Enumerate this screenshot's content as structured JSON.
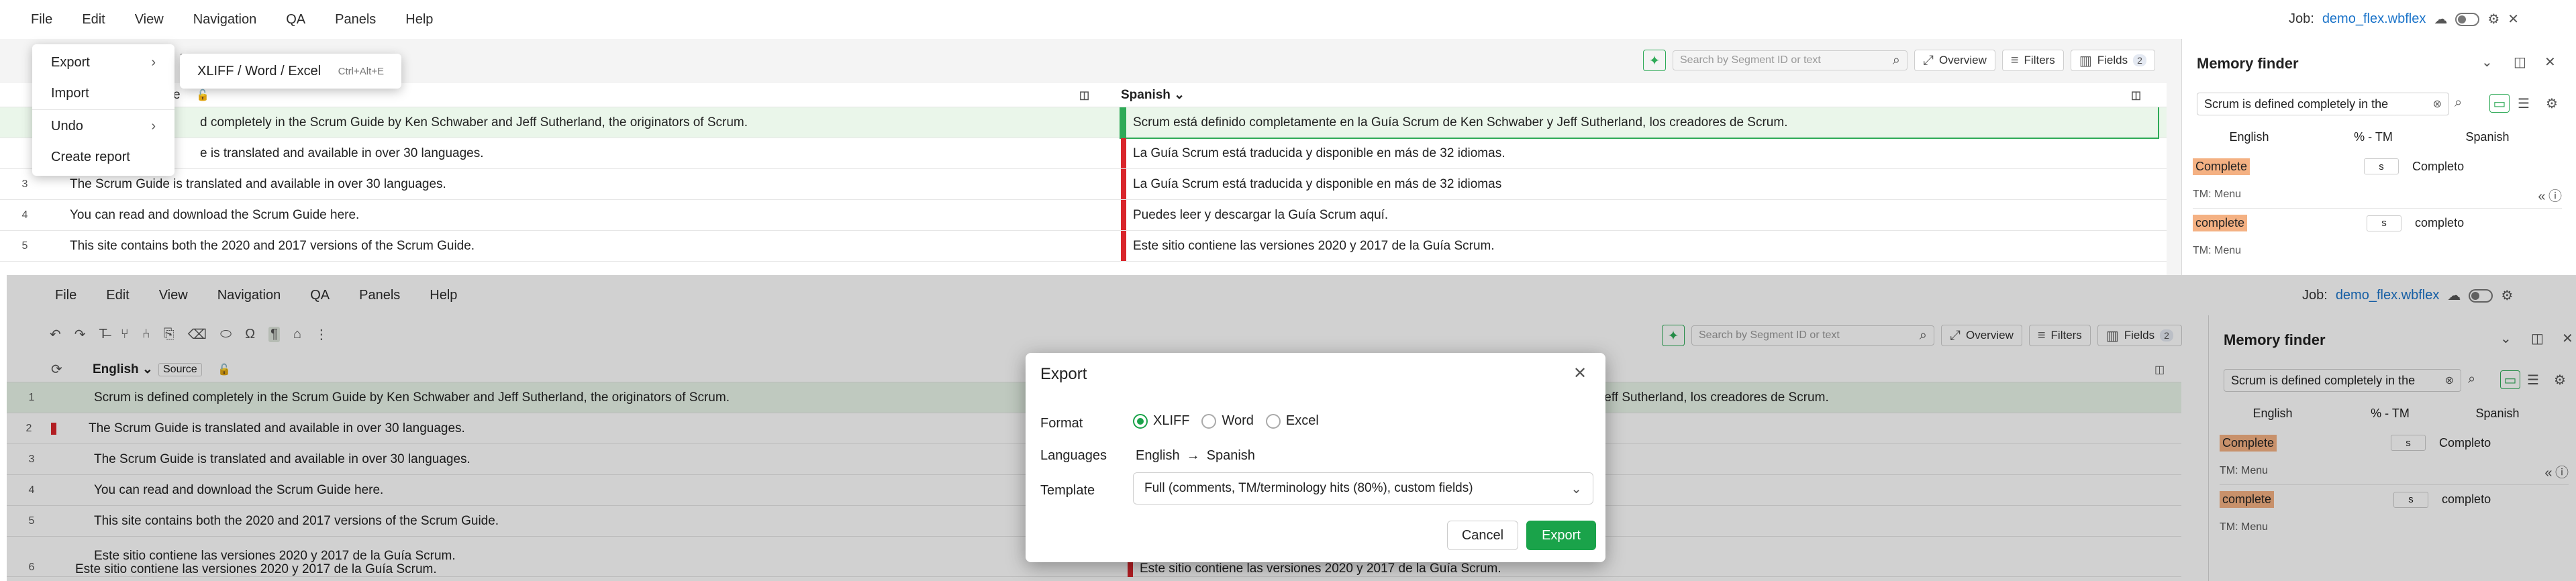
{
  "menu": [
    "File",
    "Edit",
    "View",
    "Navigation",
    "QA",
    "Panels",
    "Help"
  ],
  "job": {
    "label": "Job:",
    "name": "demo_flex.wbflex"
  },
  "search": {
    "placeholder": "Search by Segment ID or text"
  },
  "toolbar": {
    "overview": "Overview",
    "filters": "Filters",
    "fields": "Fields",
    "fields_count": "2"
  },
  "columns": {
    "source": "English",
    "source_tag": "Source",
    "target": "Spanish"
  },
  "segments": [
    {
      "n": "1",
      "src": "Scrum is defined completely in the Scrum Guide by Ken Schwaber and Jeff Sutherland, the originators of Scrum.",
      "tgt": "Scrum está definido completamente en la Guía Scrum de Ken Schwaber y Jeff Sutherland, los creadores de Scrum."
    },
    {
      "n": "2",
      "src": "The Scrum Guide is translated and available in over 30 languages.",
      "tgt": "La Guía Scrum está traducida y disponible en más de 32 idiomas."
    },
    {
      "n": "3",
      "src": "The Scrum Guide is translated and available in over 30 languages.",
      "tgt": "La Guía Scrum está traducida y disponible en más de 32 idiomas"
    },
    {
      "n": "4",
      "src": "You can read and download the Scrum Guide here.",
      "tgt": "Puedes leer y descargar la Guía Scrum aquí."
    },
    {
      "n": "5",
      "src": "This site contains both the 2020 and 2017 versions of the Scrum Guide.",
      "tgt": "Este sitio contiene las versiones 2020 y 2017 de la Guía Scrum."
    },
    {
      "n": "6",
      "src": "Este sitio contiene las versiones 2020 y 2017 de la Guía Scrum.",
      "tgt": "Este sitio contiene las versiones 2020 y 2017 de la Guía Scrum."
    }
  ],
  "top_partial": {
    "row1_src": "d completely in the Scrum Guide by Ken Schwaber and Jeff Sutherland, the originators of Scrum.",
    "row2_src": "e is translated and available in over 30 languages.",
    "header_frag_a": "N",
    "header_frag_b": "e"
  },
  "bottom_partial": {
    "row1_tgt_tail": "y Jeff Sutherland, los creadores de Scrum."
  },
  "memory": {
    "title": "Memory finder",
    "query": "Scrum is defined completely in the",
    "col_en": "English",
    "col_pct": "% - TM",
    "col_es": "Spanish",
    "hits": [
      {
        "en": "Complete",
        "chip": "s",
        "es": "Completo",
        "tm": "TM: Menu"
      },
      {
        "en": "complete",
        "chip": "s",
        "es": "completo",
        "tm": "TM: Menu"
      }
    ]
  },
  "file_menu": {
    "items": [
      "Export",
      "Import",
      "Undo",
      "Create report"
    ],
    "submenu": {
      "label": "XLIFF / Word / Excel",
      "shortcut": "Ctrl+Alt+E"
    }
  },
  "export_dialog": {
    "title": "Export",
    "format_label": "Format",
    "formats": [
      "XLIFF",
      "Word",
      "Excel"
    ],
    "selected_format": "XLIFF",
    "languages_label": "Languages",
    "lang_from": "English",
    "lang_to": "Spanish",
    "template_label": "Template",
    "template_value": "Full (comments, TM/terminology hits (80%), custom fields)",
    "cancel": "Cancel",
    "export": "Export"
  }
}
